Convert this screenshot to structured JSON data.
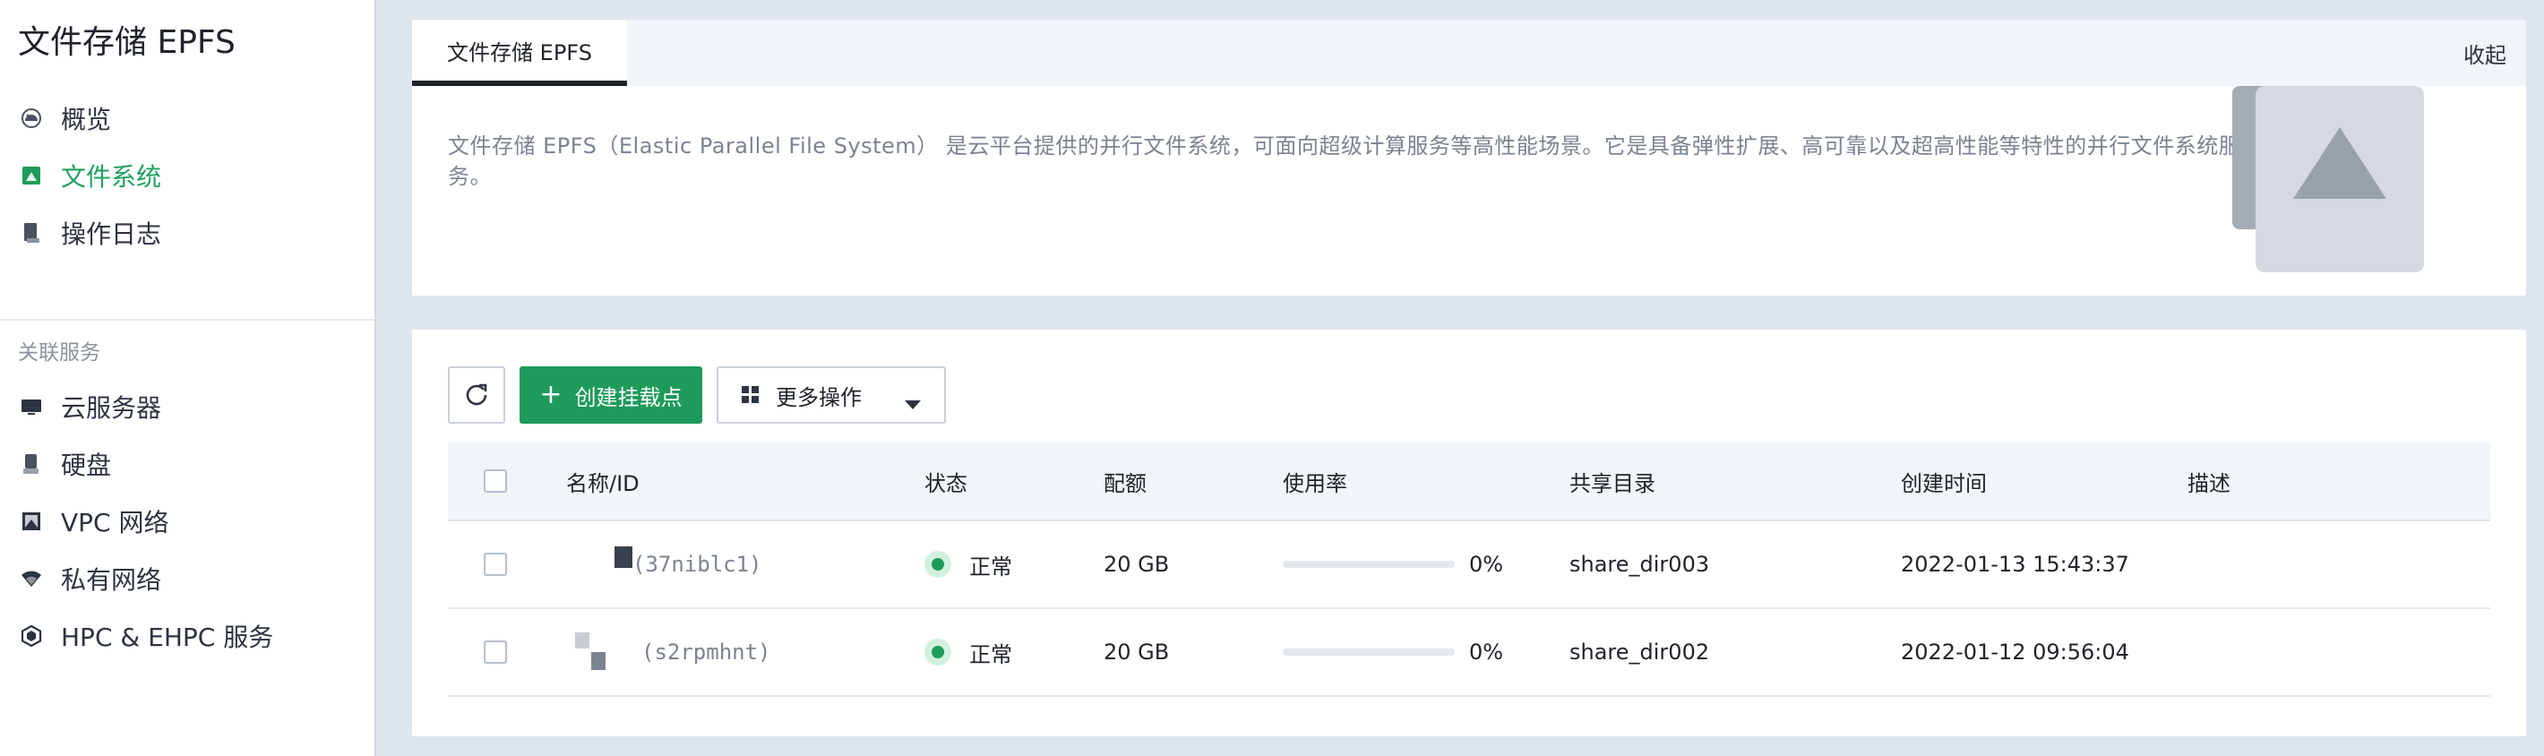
{
  "sidebar": {
    "title": "文件存储 EPFS",
    "items": [
      {
        "label": "概览",
        "icon": "dashboard-icon"
      },
      {
        "label": "文件系统",
        "icon": "file-system-icon"
      },
      {
        "label": "操作日志",
        "icon": "log-icon"
      }
    ],
    "related_label": "关联服务",
    "related_items": [
      {
        "label": "云服务器",
        "icon": "monitor-icon"
      },
      {
        "label": "硬盘",
        "icon": "disk-icon"
      },
      {
        "label": "VPC 网络",
        "icon": "vpc-icon"
      },
      {
        "label": "私有网络",
        "icon": "wifi-icon"
      },
      {
        "label": "HPC & EHPC 服务",
        "icon": "hpc-icon"
      }
    ]
  },
  "intro": {
    "tab_label": "文件存储 EPFS",
    "collapse_label": "收起",
    "description": "文件存储 EPFS（Elastic Parallel File System） 是云平台提供的并行文件系统，可面向超级计算服务等高性能场景。它是具备弹性扩展、高可靠以及超高性能等特性的并行文件系统服务。"
  },
  "toolbar": {
    "create_label": "创建挂载点",
    "more_label": "更多操作"
  },
  "table": {
    "columns": [
      "名称/ID",
      "状态",
      "配额",
      "使用率",
      "共享目录",
      "创建时间",
      "描述"
    ],
    "rows": [
      {
        "id": "(37niblc1)",
        "status": "正常",
        "quota": "20 GB",
        "usage_pct": 0,
        "usage_label": "0%",
        "share_dir": "share_dir003",
        "created": "2022-01-13 15:43:37",
        "desc": ""
      },
      {
        "id": "(s2rpmhnt)",
        "status": "正常",
        "quota": "20 GB",
        "usage_pct": 0,
        "usage_label": "0%",
        "share_dir": "share_dir002",
        "created": "2022-01-12 09:56:04",
        "desc": ""
      }
    ]
  },
  "colors": {
    "accent": "#1e9b5a",
    "page_bg": "#dfe5ec",
    "muted_text": "#7b8390"
  }
}
